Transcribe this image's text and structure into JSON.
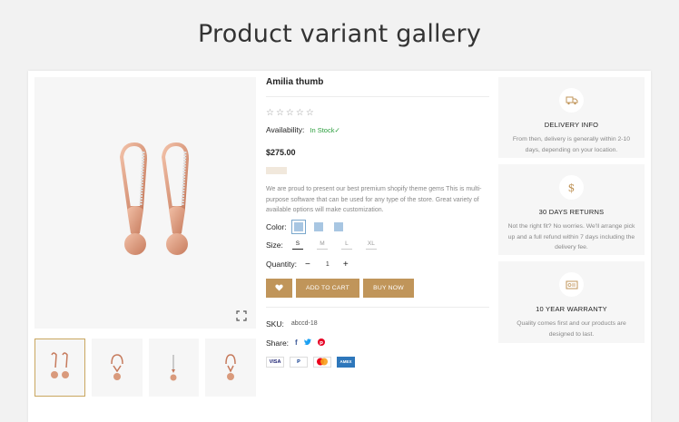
{
  "page": {
    "title": "Product variant gallery"
  },
  "product": {
    "name": "Amilia thumb",
    "rating_empty_stars": "☆☆☆☆☆",
    "availability_label": "Availability:",
    "availability_value": "In Stock✓",
    "price": "$275.00",
    "description": "We are proud to present our best premium shopify theme gems This is multi-purpose software that can be used for any type of the store. Great variety of available options will make customization.",
    "color_label": "Color:",
    "colors": [
      "#a8c6e2",
      "#a8c6e2",
      "#a8c6e2"
    ],
    "size_label": "Size:",
    "sizes": [
      "S",
      "M",
      "L",
      "XL"
    ],
    "selected_size": "S",
    "quantity_label": "Quantity:",
    "quantity_minus": "−",
    "quantity_value": "1",
    "quantity_plus": "+",
    "add_to_cart": "ADD TO CART",
    "buy_now": "BUY NOW",
    "sku_label": "SKU:",
    "sku_value": "abccd-18",
    "share_label": "Share:",
    "payments": [
      "VISA",
      "P",
      "MC",
      "AMEX"
    ]
  },
  "accent_color": "#c0955a",
  "features": [
    {
      "icon": "truck-icon",
      "title": "DELIVERY INFO",
      "text": "From then, delivery is generally within 2-10 days, depending on your location."
    },
    {
      "icon": "dollar-icon",
      "title": "30 DAYS RETURNS",
      "text": "Not the right fit? No worries. We'll arrange pick up and a full refund within 7 days including the delivery fee."
    },
    {
      "icon": "certificate-icon",
      "title": "10 YEAR WARRANTY",
      "text": "Quality comes first and our products are designed to last."
    }
  ]
}
